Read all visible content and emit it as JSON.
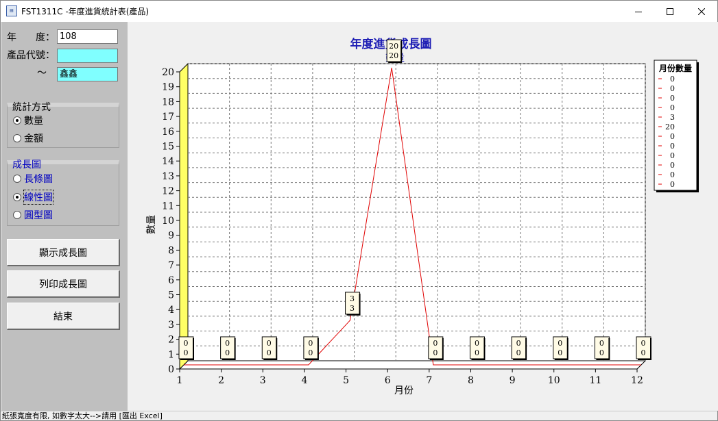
{
  "window": {
    "title": "FST1311C -年度進貨統計表(產品)",
    "icon": "app-icon"
  },
  "form": {
    "year_label": "年　　度：",
    "year_value": "108",
    "product_code_label": "產品代號：",
    "product_from_value": "",
    "tilde": "～",
    "product_to_value": "鑫鑫"
  },
  "stat_method": {
    "legend": "統計方式",
    "options": [
      {
        "label": "數量",
        "selected": true
      },
      {
        "label": "金額",
        "selected": false
      }
    ]
  },
  "growth_chart": {
    "legend": "成長圖",
    "options": [
      {
        "label": "長條圖",
        "selected": false
      },
      {
        "label": "線性圖",
        "selected": true
      },
      {
        "label": "圓型圖",
        "selected": false
      }
    ]
  },
  "buttons": {
    "show": "顯示成長圖",
    "print": "列印成長圖",
    "exit": "結束"
  },
  "status_text": "紙張寬度有限, 如數字太大-->請用 [匯出 Excel]",
  "chart_data": {
    "type": "line",
    "title": "年度進貨成長圖",
    "subtitle": "數量",
    "xlabel": "月份",
    "ylabel": "數量",
    "categories": [
      "1",
      "2",
      "3",
      "4",
      "5",
      "6",
      "7",
      "8",
      "9",
      "10",
      "11",
      "12"
    ],
    "series": [
      {
        "name": "月份數量",
        "values": [
          0,
          0,
          0,
          0,
          3,
          20,
          0,
          0,
          0,
          0,
          0,
          0
        ],
        "color": "#e00000"
      }
    ],
    "ylim": [
      0,
      20
    ],
    "yticks": [
      "0",
      "1",
      "2",
      "3",
      "4",
      "5",
      "6",
      "7",
      "8",
      "9",
      "10",
      "11",
      "12",
      "13",
      "14",
      "15",
      "16",
      "17",
      "18",
      "19",
      "20"
    ],
    "grid": true,
    "legend_position": "right",
    "legend_title": "月份數量",
    "legend_values": [
      "0",
      "0",
      "0",
      "0",
      "3",
      "20",
      "0",
      "0",
      "0",
      "0",
      "0",
      "0"
    ],
    "wall_color": "#ffff66"
  }
}
